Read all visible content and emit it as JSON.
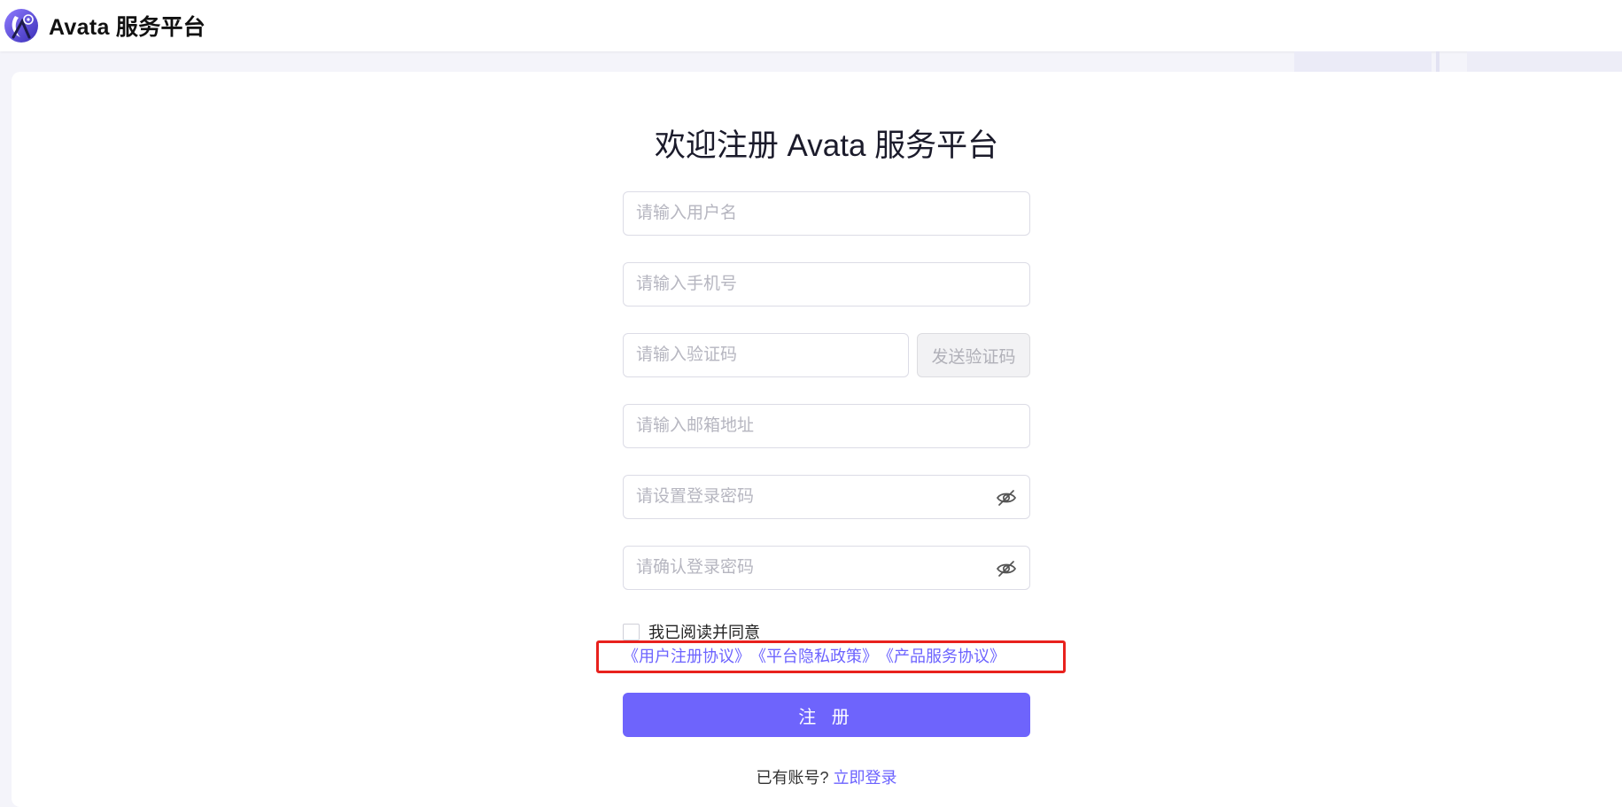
{
  "header": {
    "brand": "Avata 服务平台",
    "logo_icon": "avata-logo-icon"
  },
  "form": {
    "title": "欢迎注册 Avata 服务平台",
    "username_placeholder": "请输入用户名",
    "phone_placeholder": "请输入手机号",
    "code_placeholder": "请输入验证码",
    "send_code_label": "发送验证码",
    "email_placeholder": "请输入邮箱地址",
    "password_placeholder": "请设置登录密码",
    "confirm_password_placeholder": "请确认登录密码",
    "agree_text": "我已阅读并同意",
    "agreements": [
      "《用户注册协议》",
      "《平台隐私政策》",
      "《产品服务协议》"
    ],
    "submit_label": "注 册",
    "have_account_text": "已有账号?",
    "login_link": "立即登录"
  },
  "colors": {
    "accent": "#6e64fc",
    "link": "#6c63ff",
    "highlight_border": "#e8211d"
  }
}
